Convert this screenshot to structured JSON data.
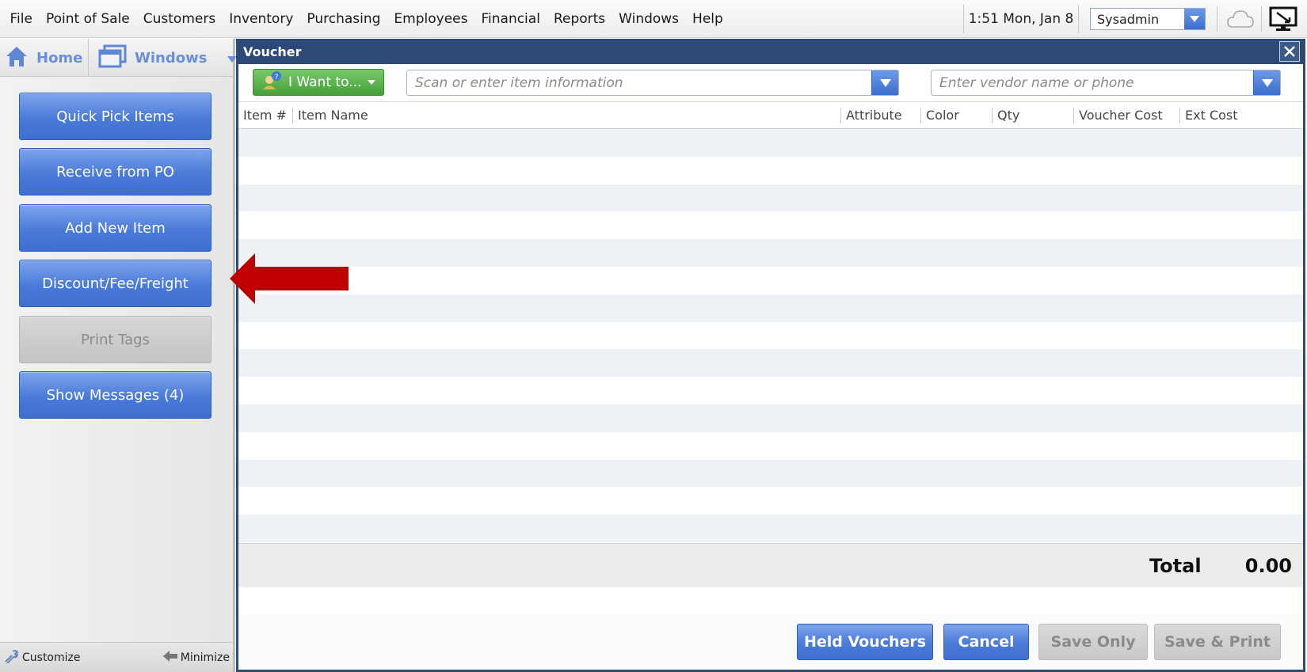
{
  "menubar": {
    "items": [
      "File",
      "Point of Sale",
      "Customers",
      "Inventory",
      "Purchasing",
      "Employees",
      "Financial",
      "Reports",
      "Windows",
      "Help"
    ],
    "clock": "1:51 Mon, Jan 8",
    "user": "Sysadmin"
  },
  "sidebar": {
    "tabs": {
      "home": "Home",
      "windows": "Windows"
    },
    "buttons": [
      {
        "label": "Quick Pick Items",
        "enabled": true
      },
      {
        "label": "Receive from PO",
        "enabled": true
      },
      {
        "label": "Add New Item",
        "enabled": true
      },
      {
        "label": "Discount/Fee/Freight",
        "enabled": true
      },
      {
        "label": "Print Tags",
        "enabled": false
      },
      {
        "label": "Show Messages (4)",
        "enabled": true
      }
    ],
    "footer": {
      "customize": "Customize",
      "minimize": "Minimize"
    }
  },
  "voucher": {
    "title": "Voucher",
    "i_want_to": "I Want to...",
    "item_search_placeholder": "Scan or enter item information",
    "vendor_search_placeholder": "Enter vendor name or phone",
    "columns": [
      "Item #",
      "Item Name",
      "Attribute",
      "Color",
      "Qty",
      "Voucher Cost",
      "Ext Cost"
    ],
    "total_label": "Total",
    "total_value": "0.00",
    "actions": {
      "held_vouchers": "Held Vouchers",
      "cancel": "Cancel",
      "save_only": "Save Only",
      "save_print": "Save & Print"
    }
  },
  "colors": {
    "title_bar": "#2b4a78",
    "button_blue": "#4a7ad8",
    "button_green": "#46a03a",
    "arrow_red": "#c00000"
  }
}
